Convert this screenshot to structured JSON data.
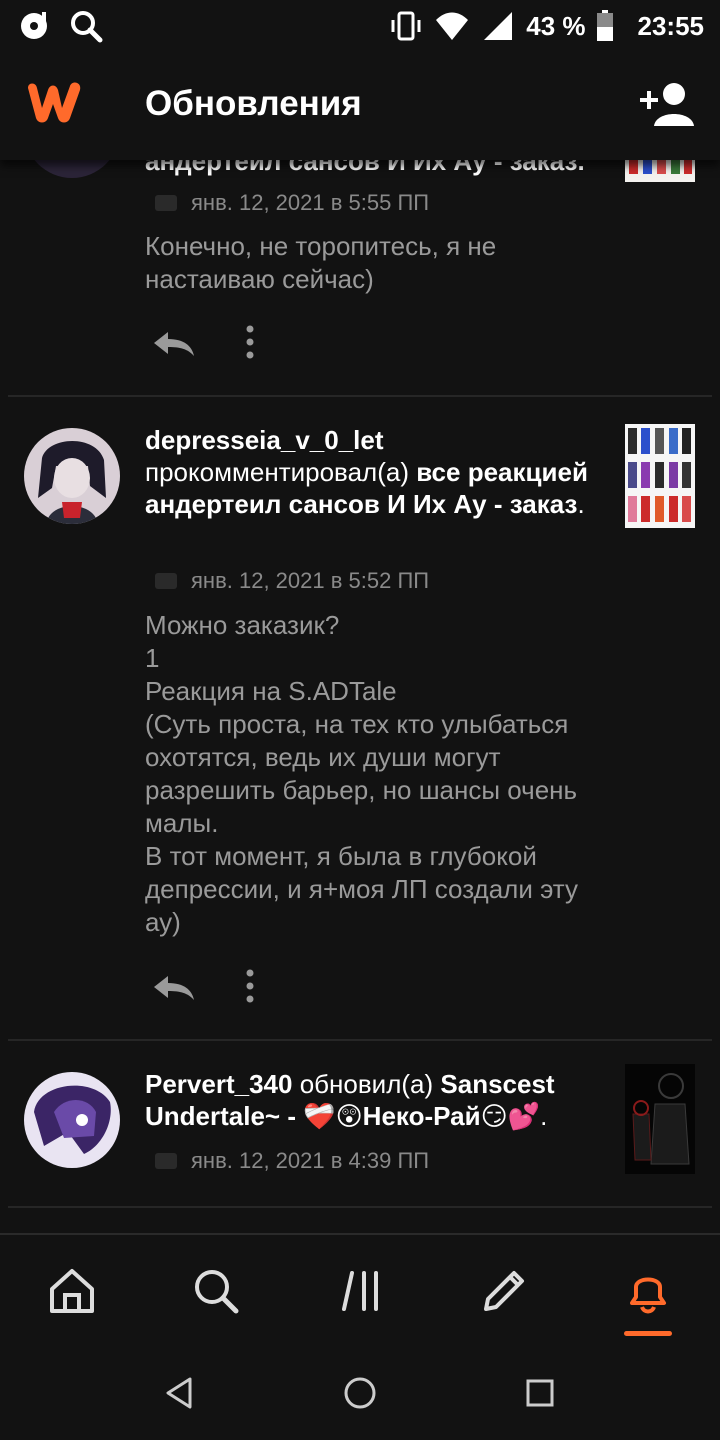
{
  "status_bar": {
    "battery": "43 %",
    "time": "23:55"
  },
  "header": {
    "title": "Обновления"
  },
  "items": [
    {
      "headline_partial": "андертеил сансов И Их Ау - заказ.",
      "date": "янв. 12, 2021 в 5:55 ПП",
      "text": "Конечно, не торопитесь, я не настаиваю сейчас)"
    },
    {
      "user": "depresseia_v_0_let",
      "action": "прокомментировал(а)",
      "story": "все реакцией андертеил сансов И Их Ау - заказ",
      "date": "янв. 12, 2021 в 5:52 ПП",
      "text": "Можно заказик?\n1\nРеакция на S.ADTale\n(Суть проста, на тех кто улыбаться охотятся, ведь их души могут разрешить барьер, но шансы очень малы.\nВ тот момент, я была в глубокой депрессии, и я+моя ЛП создали эту ау)"
    },
    {
      "user": "Pervert_340",
      "action": "обновил(а)",
      "story": "Sanscest Undertale~ - ❤️‍🩹😲Неко-Рай😏💕",
      "date": "янв. 12, 2021 в 4:39 ПП"
    }
  ],
  "colors": {
    "accent": "#ff6a2b",
    "background": "#121212",
    "muted_text": "#9a9a9a"
  }
}
